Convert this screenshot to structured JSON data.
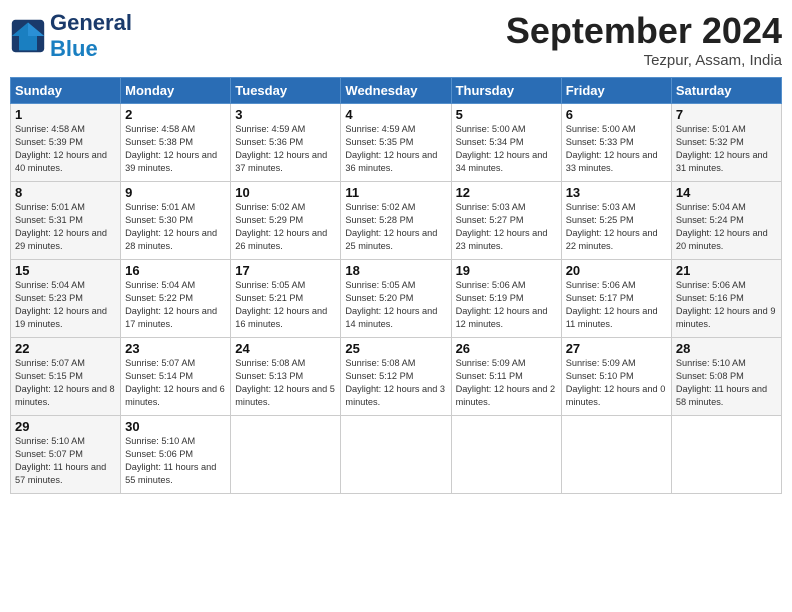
{
  "header": {
    "logo_text_general": "General",
    "logo_text_blue": "Blue",
    "month_title": "September 2024",
    "location": "Tezpur, Assam, India"
  },
  "days_of_week": [
    "Sunday",
    "Monday",
    "Tuesday",
    "Wednesday",
    "Thursday",
    "Friday",
    "Saturday"
  ],
  "weeks": [
    [
      {
        "day": "1",
        "sunrise": "Sunrise: 4:58 AM",
        "sunset": "Sunset: 5:39 PM",
        "daylight": "Daylight: 12 hours and 40 minutes."
      },
      {
        "day": "2",
        "sunrise": "Sunrise: 4:58 AM",
        "sunset": "Sunset: 5:38 PM",
        "daylight": "Daylight: 12 hours and 39 minutes."
      },
      {
        "day": "3",
        "sunrise": "Sunrise: 4:59 AM",
        "sunset": "Sunset: 5:36 PM",
        "daylight": "Daylight: 12 hours and 37 minutes."
      },
      {
        "day": "4",
        "sunrise": "Sunrise: 4:59 AM",
        "sunset": "Sunset: 5:35 PM",
        "daylight": "Daylight: 12 hours and 36 minutes."
      },
      {
        "day": "5",
        "sunrise": "Sunrise: 5:00 AM",
        "sunset": "Sunset: 5:34 PM",
        "daylight": "Daylight: 12 hours and 34 minutes."
      },
      {
        "day": "6",
        "sunrise": "Sunrise: 5:00 AM",
        "sunset": "Sunset: 5:33 PM",
        "daylight": "Daylight: 12 hours and 33 minutes."
      },
      {
        "day": "7",
        "sunrise": "Sunrise: 5:01 AM",
        "sunset": "Sunset: 5:32 PM",
        "daylight": "Daylight: 12 hours and 31 minutes."
      }
    ],
    [
      {
        "day": "8",
        "sunrise": "Sunrise: 5:01 AM",
        "sunset": "Sunset: 5:31 PM",
        "daylight": "Daylight: 12 hours and 29 minutes."
      },
      {
        "day": "9",
        "sunrise": "Sunrise: 5:01 AM",
        "sunset": "Sunset: 5:30 PM",
        "daylight": "Daylight: 12 hours and 28 minutes."
      },
      {
        "day": "10",
        "sunrise": "Sunrise: 5:02 AM",
        "sunset": "Sunset: 5:29 PM",
        "daylight": "Daylight: 12 hours and 26 minutes."
      },
      {
        "day": "11",
        "sunrise": "Sunrise: 5:02 AM",
        "sunset": "Sunset: 5:28 PM",
        "daylight": "Daylight: 12 hours and 25 minutes."
      },
      {
        "day": "12",
        "sunrise": "Sunrise: 5:03 AM",
        "sunset": "Sunset: 5:27 PM",
        "daylight": "Daylight: 12 hours and 23 minutes."
      },
      {
        "day": "13",
        "sunrise": "Sunrise: 5:03 AM",
        "sunset": "Sunset: 5:25 PM",
        "daylight": "Daylight: 12 hours and 22 minutes."
      },
      {
        "day": "14",
        "sunrise": "Sunrise: 5:04 AM",
        "sunset": "Sunset: 5:24 PM",
        "daylight": "Daylight: 12 hours and 20 minutes."
      }
    ],
    [
      {
        "day": "15",
        "sunrise": "Sunrise: 5:04 AM",
        "sunset": "Sunset: 5:23 PM",
        "daylight": "Daylight: 12 hours and 19 minutes."
      },
      {
        "day": "16",
        "sunrise": "Sunrise: 5:04 AM",
        "sunset": "Sunset: 5:22 PM",
        "daylight": "Daylight: 12 hours and 17 minutes."
      },
      {
        "day": "17",
        "sunrise": "Sunrise: 5:05 AM",
        "sunset": "Sunset: 5:21 PM",
        "daylight": "Daylight: 12 hours and 16 minutes."
      },
      {
        "day": "18",
        "sunrise": "Sunrise: 5:05 AM",
        "sunset": "Sunset: 5:20 PM",
        "daylight": "Daylight: 12 hours and 14 minutes."
      },
      {
        "day": "19",
        "sunrise": "Sunrise: 5:06 AM",
        "sunset": "Sunset: 5:19 PM",
        "daylight": "Daylight: 12 hours and 12 minutes."
      },
      {
        "day": "20",
        "sunrise": "Sunrise: 5:06 AM",
        "sunset": "Sunset: 5:17 PM",
        "daylight": "Daylight: 12 hours and 11 minutes."
      },
      {
        "day": "21",
        "sunrise": "Sunrise: 5:06 AM",
        "sunset": "Sunset: 5:16 PM",
        "daylight": "Daylight: 12 hours and 9 minutes."
      }
    ],
    [
      {
        "day": "22",
        "sunrise": "Sunrise: 5:07 AM",
        "sunset": "Sunset: 5:15 PM",
        "daylight": "Daylight: 12 hours and 8 minutes."
      },
      {
        "day": "23",
        "sunrise": "Sunrise: 5:07 AM",
        "sunset": "Sunset: 5:14 PM",
        "daylight": "Daylight: 12 hours and 6 minutes."
      },
      {
        "day": "24",
        "sunrise": "Sunrise: 5:08 AM",
        "sunset": "Sunset: 5:13 PM",
        "daylight": "Daylight: 12 hours and 5 minutes."
      },
      {
        "day": "25",
        "sunrise": "Sunrise: 5:08 AM",
        "sunset": "Sunset: 5:12 PM",
        "daylight": "Daylight: 12 hours and 3 minutes."
      },
      {
        "day": "26",
        "sunrise": "Sunrise: 5:09 AM",
        "sunset": "Sunset: 5:11 PM",
        "daylight": "Daylight: 12 hours and 2 minutes."
      },
      {
        "day": "27",
        "sunrise": "Sunrise: 5:09 AM",
        "sunset": "Sunset: 5:10 PM",
        "daylight": "Daylight: 12 hours and 0 minutes."
      },
      {
        "day": "28",
        "sunrise": "Sunrise: 5:10 AM",
        "sunset": "Sunset: 5:08 PM",
        "daylight": "Daylight: 11 hours and 58 minutes."
      }
    ],
    [
      {
        "day": "29",
        "sunrise": "Sunrise: 5:10 AM",
        "sunset": "Sunset: 5:07 PM",
        "daylight": "Daylight: 11 hours and 57 minutes."
      },
      {
        "day": "30",
        "sunrise": "Sunrise: 5:10 AM",
        "sunset": "Sunset: 5:06 PM",
        "daylight": "Daylight: 11 hours and 55 minutes."
      },
      {
        "day": "",
        "sunrise": "",
        "sunset": "",
        "daylight": ""
      },
      {
        "day": "",
        "sunrise": "",
        "sunset": "",
        "daylight": ""
      },
      {
        "day": "",
        "sunrise": "",
        "sunset": "",
        "daylight": ""
      },
      {
        "day": "",
        "sunrise": "",
        "sunset": "",
        "daylight": ""
      },
      {
        "day": "",
        "sunrise": "",
        "sunset": "",
        "daylight": ""
      }
    ]
  ]
}
